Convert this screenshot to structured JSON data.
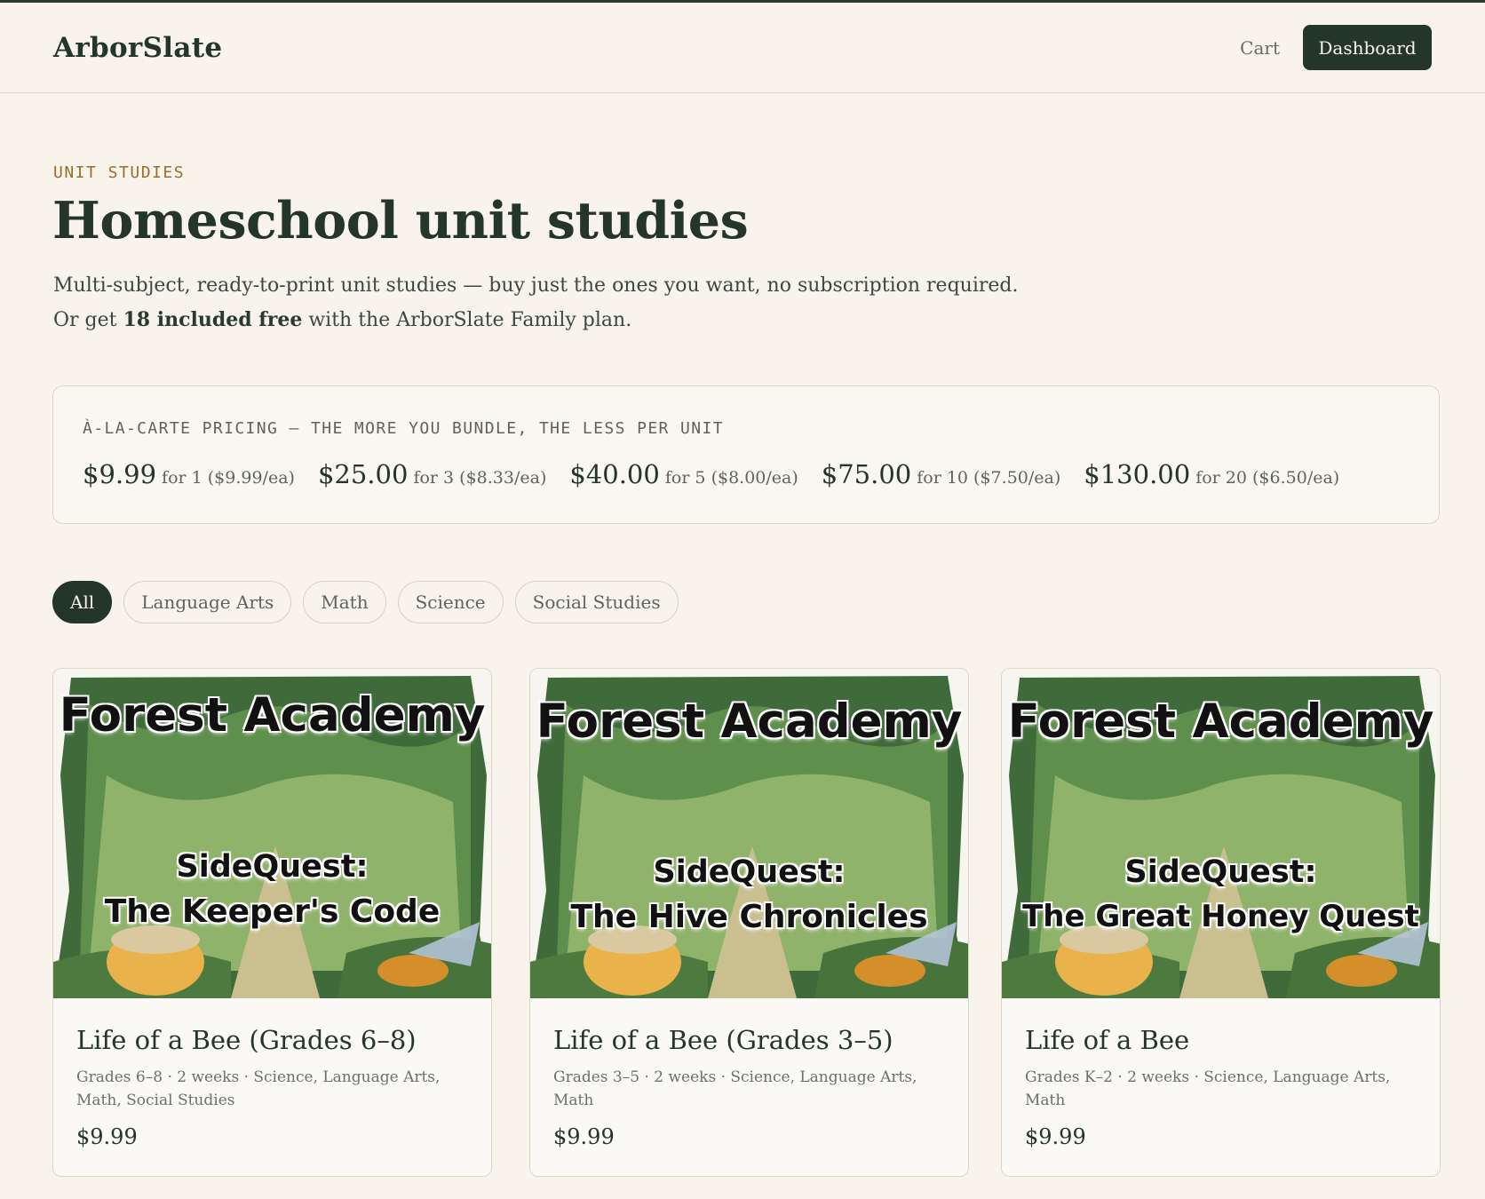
{
  "header": {
    "brand": "ArborSlate",
    "cart_label": "Cart",
    "dashboard_label": "Dashboard"
  },
  "hero": {
    "eyebrow": "UNIT STUDIES",
    "title": "Homeschool unit studies",
    "lede_part1": "Multi-subject, ready-to-print unit studies — buy just the ones you want, no subscription required. Or get ",
    "lede_bold": "18 included free",
    "lede_part2": " with the ArborSlate Family plan."
  },
  "pricing": {
    "label": "À-LA-CARTE PRICING — THE MORE YOU BUNDLE, THE LESS PER UNIT",
    "tiers": [
      {
        "price": "$9.99",
        "detail": "for 1 ($9.99/ea)"
      },
      {
        "price": "$25.00",
        "detail": "for 3 ($8.33/ea)"
      },
      {
        "price": "$40.00",
        "detail": "for 5 ($8.00/ea)"
      },
      {
        "price": "$75.00",
        "detail": "for 10 ($7.50/ea)"
      },
      {
        "price": "$130.00",
        "detail": "for 20 ($6.50/ea)"
      }
    ]
  },
  "filters": [
    {
      "label": "All",
      "active": true
    },
    {
      "label": "Language Arts",
      "active": false
    },
    {
      "label": "Math",
      "active": false
    },
    {
      "label": "Science",
      "active": false
    },
    {
      "label": "Social Studies",
      "active": false
    }
  ],
  "products": [
    {
      "cover_brand": "Forest Academy",
      "cover_side": "SideQuest:",
      "cover_title": "The Keeper's Code",
      "title": "Life of a Bee (Grades 6–8)",
      "meta": "Grades 6–8 · 2 weeks · Science, Language Arts, Math, Social Studies",
      "price": "$9.99"
    },
    {
      "cover_brand": "Forest Academy",
      "cover_side": "SideQuest:",
      "cover_title": "The Hive Chronicles",
      "title": "Life of a Bee (Grades 3–5)",
      "meta": "Grades 3–5 · 2 weeks · Science, Language Arts, Math",
      "price": "$9.99"
    },
    {
      "cover_brand": "Forest Academy",
      "cover_side": "SideQuest:",
      "cover_title": "The Great Honey Quest",
      "title": "Life of a Bee",
      "meta": "Grades K–2 · 2 weeks · Science, Language Arts, Math",
      "price": "$9.99"
    }
  ]
}
